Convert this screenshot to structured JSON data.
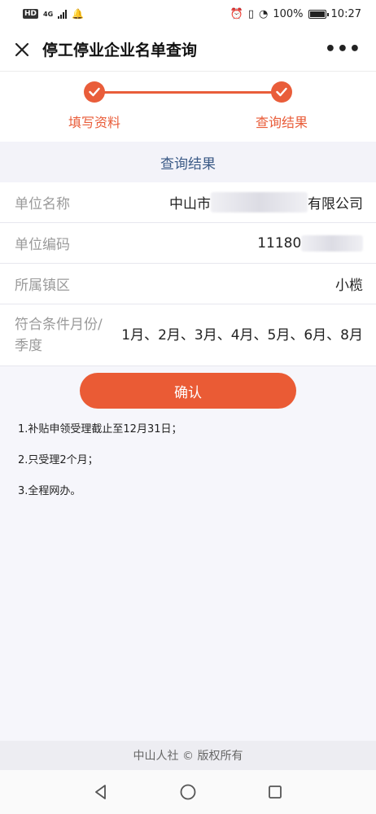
{
  "status_bar": {
    "network_badge": "HD",
    "network_type": "4G",
    "battery_text": "100%",
    "time": "10:27"
  },
  "header": {
    "title": "停工停业企业名单查询",
    "close_icon": "close-icon",
    "more_icon": "more-icon"
  },
  "steps": [
    {
      "label": "填写资料",
      "state": "done"
    },
    {
      "label": "查询结果",
      "state": "done"
    }
  ],
  "result": {
    "header": "查询结果",
    "rows": [
      {
        "label": "单位名称",
        "value_prefix": "中山市",
        "value_suffix": "有限公司"
      },
      {
        "label": "单位编码",
        "value_prefix": "11180",
        "value_suffix": ""
      },
      {
        "label": "所属镇区",
        "value_prefix": "小榄",
        "value_suffix": ""
      },
      {
        "label": "符合条件月份/季度",
        "value_prefix": "1月、2月、3月、4月、5月、6月、8月",
        "value_suffix": ""
      }
    ]
  },
  "confirm_button": {
    "label": "确认"
  },
  "notes": [
    "1.补贴申领受理截止至12月31日；",
    "2.只受理2个月；",
    "3.全程网办。"
  ],
  "footer": {
    "text": "中山人社 © 版权所有"
  },
  "colors": {
    "accent": "#e95d3a",
    "header_text": "#3b5a86"
  }
}
